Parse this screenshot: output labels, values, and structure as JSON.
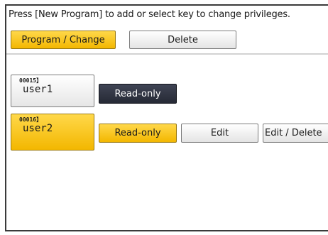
{
  "instruction": "Press [New Program] to add or select key to change privileges.",
  "tabs": {
    "program_change": "Program / Change",
    "delete": "Delete"
  },
  "users": [
    {
      "id": "　00015】",
      "name": "user1",
      "privilege": "Read-only",
      "selected": false
    },
    {
      "id": "　00016】",
      "name": "user2",
      "privilege": "Read-only",
      "selected": true
    }
  ],
  "privilege_options": {
    "read_only": "Read-only",
    "edit": "Edit",
    "edit_delete": "Edit / Delete"
  },
  "colors": {
    "accent_yellow": "#f3b700",
    "selected_dark": "#262a35"
  }
}
